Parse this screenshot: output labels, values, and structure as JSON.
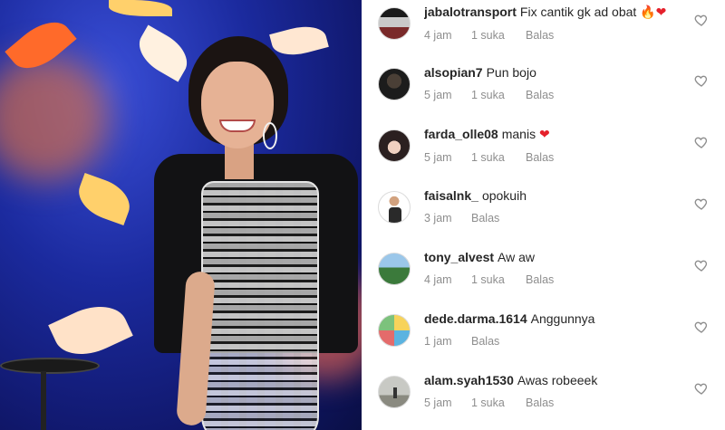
{
  "comments": [
    {
      "username": "jabalotransport",
      "text": "Fix cantik gk ad obat",
      "emojis": [
        "🔥",
        "❤"
      ],
      "time": "4 jam",
      "likes": "1 suka",
      "reply": "Balas"
    },
    {
      "username": "alsopian7",
      "text": "Pun bojo",
      "emojis": [],
      "time": "5 jam",
      "likes": "1 suka",
      "reply": "Balas"
    },
    {
      "username": "farda_olle08",
      "text": "manis",
      "emojis": [
        "❤"
      ],
      "time": "5 jam",
      "likes": "1 suka",
      "reply": "Balas"
    },
    {
      "username": "faisalnk_",
      "text": "opokuih",
      "emojis": [],
      "time": "3 jam",
      "likes": "",
      "reply": "Balas"
    },
    {
      "username": "tony_alvest",
      "text": "Aw aw",
      "emojis": [],
      "time": "4 jam",
      "likes": "1 suka",
      "reply": "Balas"
    },
    {
      "username": "dede.darma.1614",
      "text": "Anggunnya",
      "emojis": [],
      "time": "1 jam",
      "likes": "",
      "reply": "Balas"
    },
    {
      "username": "alam.syah1530",
      "text": "Awas robeeek",
      "emojis": [],
      "time": "5 jam",
      "likes": "1 suka",
      "reply": "Balas"
    }
  ],
  "icons": {
    "like": "heart-outline-icon"
  },
  "colors": {
    "username": "#262626",
    "meta": "#8e8e8e",
    "heart_outline": "#8e8e8e",
    "emoji_heart": "#e5202b",
    "emoji_fire": "#ff6b00"
  }
}
